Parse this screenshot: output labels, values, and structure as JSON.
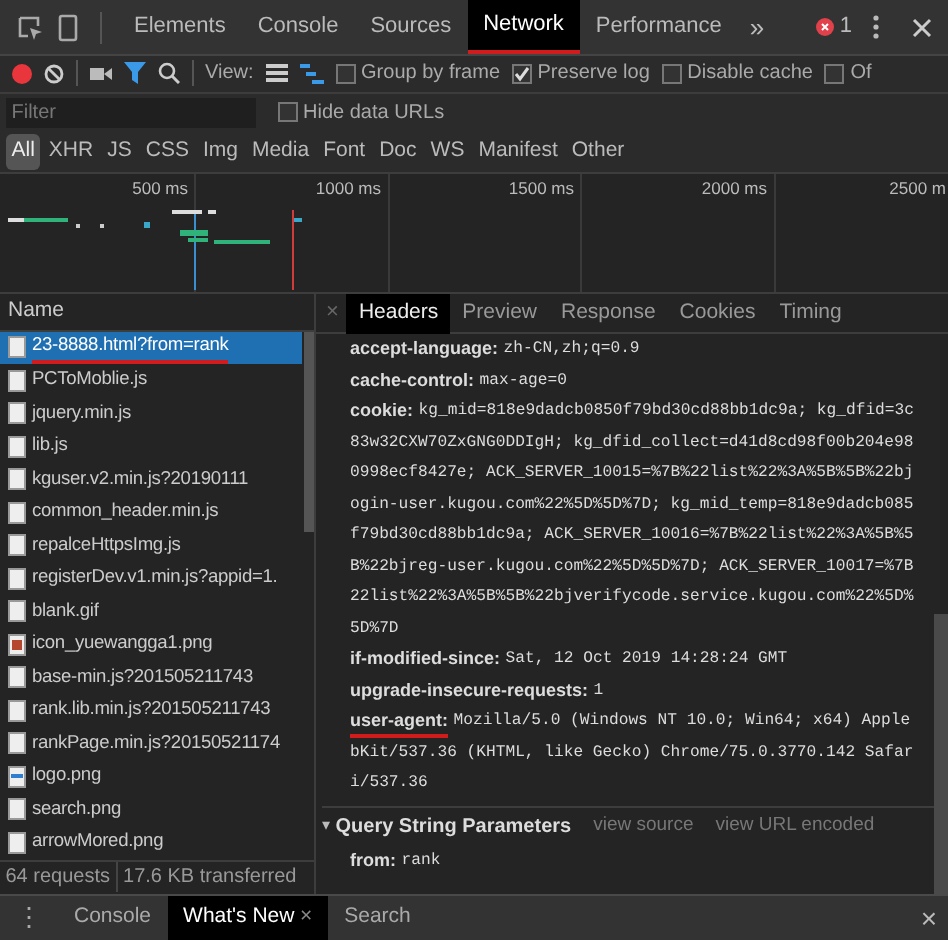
{
  "main_tabs": [
    {
      "label": "Elements",
      "selected": false,
      "underlined": false
    },
    {
      "label": "Console",
      "selected": false,
      "underlined": false
    },
    {
      "label": "Sources",
      "selected": false,
      "underlined": false
    },
    {
      "label": "Network",
      "selected": true,
      "underlined": true
    },
    {
      "label": "Performance",
      "selected": false,
      "underlined": false
    }
  ],
  "more_tabs": "»",
  "error_count": "1",
  "toolbar": {
    "recording": true,
    "filter_active": true,
    "view_label": "View:",
    "waterfall_view": true,
    "options": [
      {
        "label": "Group by frame",
        "checked": false
      },
      {
        "label": "Preserve log",
        "checked": true
      },
      {
        "label": "Disable cache",
        "checked": false
      },
      {
        "label": "Of",
        "checked": false
      }
    ]
  },
  "filter": {
    "placeholder": "Filter",
    "hide_data_urls": {
      "label": "Hide data URLs",
      "checked": false
    }
  },
  "type_filters": [
    {
      "label": "All",
      "selected": true
    },
    {
      "label": "XHR",
      "selected": false
    },
    {
      "label": "JS",
      "selected": false
    },
    {
      "label": "CSS",
      "selected": false
    },
    {
      "label": "Img",
      "selected": false
    },
    {
      "label": "Media",
      "selected": false
    },
    {
      "label": "Font",
      "selected": false
    },
    {
      "label": "Doc",
      "selected": false
    },
    {
      "label": "WS",
      "selected": false
    },
    {
      "label": "Manifest",
      "selected": false
    },
    {
      "label": "Other",
      "selected": false
    }
  ],
  "timeline_ticks": [
    "500 ms",
    "1000 ms",
    "1500 ms",
    "2000 ms",
    "2500 m"
  ],
  "requests": {
    "header": "Name",
    "items": [
      {
        "name": "23-8888.html?from=rank",
        "kind": "document",
        "selected": true,
        "underlined": true
      },
      {
        "name": "PCToMoblie.js",
        "kind": "document",
        "selected": false,
        "underlined": false
      },
      {
        "name": "jquery.min.js",
        "kind": "document",
        "selected": false,
        "underlined": false
      },
      {
        "name": "lib.js",
        "kind": "document",
        "selected": false,
        "underlined": false
      },
      {
        "name": "kguser.v2.min.js?20190111",
        "kind": "document",
        "selected": false,
        "underlined": false
      },
      {
        "name": "common_header.min.js",
        "kind": "document",
        "selected": false,
        "underlined": false
      },
      {
        "name": "repalceHttpsImg.js",
        "kind": "document",
        "selected": false,
        "underlined": false
      },
      {
        "name": "registerDev.v1.min.js?appid=1.",
        "kind": "document",
        "selected": false,
        "underlined": false
      },
      {
        "name": "blank.gif",
        "kind": "document",
        "selected": false,
        "underlined": false
      },
      {
        "name": "icon_yuewangga1.png",
        "kind": "image",
        "selected": false,
        "underlined": false
      },
      {
        "name": "base-min.js?201505211743",
        "kind": "document",
        "selected": false,
        "underlined": false
      },
      {
        "name": "rank.lib.min.js?201505211743",
        "kind": "document",
        "selected": false,
        "underlined": false
      },
      {
        "name": "rankPage.min.js?20150521174",
        "kind": "document",
        "selected": false,
        "underlined": false
      },
      {
        "name": "logo.png",
        "kind": "logo",
        "selected": false,
        "underlined": false
      },
      {
        "name": "search.png",
        "kind": "document",
        "selected": false,
        "underlined": false
      },
      {
        "name": "arrowMored.png",
        "kind": "document",
        "selected": false,
        "underlined": false
      }
    ]
  },
  "status_bar": [
    "64 requests",
    "17.6 KB transferred"
  ],
  "detail_close": "×",
  "detail_tabs": [
    {
      "label": "Headers",
      "selected": true
    },
    {
      "label": "Preview",
      "selected": false
    },
    {
      "label": "Response",
      "selected": false
    },
    {
      "label": "Cookies",
      "selected": false
    },
    {
      "label": "Timing",
      "selected": false
    }
  ],
  "headers": [
    {
      "name": "accept-language:",
      "underlined": false,
      "value_lines": [
        "zh-CN,zh;q=0.9"
      ]
    },
    {
      "name": "cache-control:",
      "underlined": false,
      "value_lines": [
        "max-age=0"
      ]
    },
    {
      "name": "cookie:",
      "underlined": false,
      "value_lines": [
        "kg_mid=818e9dadcb0850f79bd30cd88bb1dc9a; kg_dfid=3c",
        "83w32CXW70ZxGNG0DDIgH; kg_dfid_collect=d41d8cd98f00b204e98",
        "0998ecf8427e; ACK_SERVER_10015=%7B%22list%22%3A%5B%5B%22bj",
        "ogin-user.kugou.com%22%5D%5D%7D; kg_mid_temp=818e9dadcb085",
        "f79bd30cd88bb1dc9a; ACK_SERVER_10016=%7B%22list%22%3A%5B%5",
        "B%22bjreg-user.kugou.com%22%5D%5D%7D; ACK_SERVER_10017=%7B",
        "22list%22%3A%5B%5B%22bjverifycode.service.kugou.com%22%5D%",
        "5D%7D"
      ]
    },
    {
      "name": "if-modified-since:",
      "underlined": false,
      "value_lines": [
        "Sat, 12 Oct 2019 14:28:24 GMT"
      ]
    },
    {
      "name": "upgrade-insecure-requests:",
      "underlined": false,
      "value_lines": [
        "1"
      ]
    },
    {
      "name": "user-agent:",
      "underlined": true,
      "value_lines": [
        "Mozilla/5.0 (Windows NT 10.0; Win64; x64) Apple",
        "bKit/537.36 (KHTML, like Gecko) Chrome/75.0.3770.142 Safar",
        "i/537.36"
      ]
    }
  ],
  "query_section": {
    "toggle": "▾",
    "title": "Query String Parameters",
    "expanded": true,
    "links": [
      "view source",
      "view URL encoded"
    ],
    "params": [
      {
        "name": "from:",
        "value": "rank"
      }
    ]
  },
  "drawer": {
    "menu": "⋮",
    "tabs": [
      {
        "label": "Console",
        "selected": false,
        "closable": false
      },
      {
        "label": "What's New",
        "selected": true,
        "closable": true
      },
      {
        "label": "Search",
        "selected": false,
        "closable": false
      }
    ],
    "close_tab": "×",
    "close": "×"
  }
}
